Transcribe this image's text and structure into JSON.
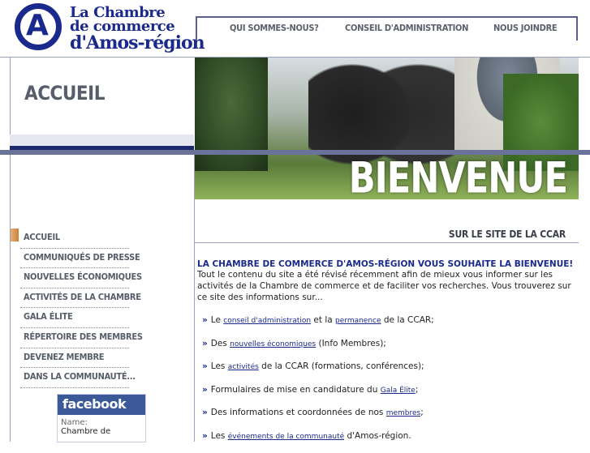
{
  "brand": {
    "l1": "La Chambre",
    "l2": "de commerce",
    "l3": "d'Amos-région",
    "icon": "logo-a-mark"
  },
  "topnav": [
    {
      "label": "QUI SOMMES-NOUS?"
    },
    {
      "label": "CONSEIL D'ADMINISTRATION"
    },
    {
      "label": "NOUS JOINDRE"
    }
  ],
  "page_title": "ACCUEIL",
  "hero": {
    "bienvenue": "BIENVENUE",
    "subtitle": "SUR LE SITE DE LA CCAR"
  },
  "sidenav": [
    {
      "label": "ACCUEIL"
    },
    {
      "label": "COMMUNIQUÉS DE PRESSE"
    },
    {
      "label": "NOUVELLES ÉCONOMIQUES"
    },
    {
      "label": "ACTIVITÉS DE LA CHAMBRE"
    },
    {
      "label": "GALA ÉLITE"
    },
    {
      "label": "RÉPERTOIRE DES MEMBRES"
    },
    {
      "label": "DEVENEZ MEMBRE"
    },
    {
      "label": "DANS LA COMMUNAUTÉ..."
    }
  ],
  "facebook": {
    "title": "facebook",
    "name_label": "Name:",
    "name_value": "Chambre de"
  },
  "content": {
    "headline": "LA CHAMBRE DE COMMERCE D'AMOS-RÉGION VOUS SOUHAITE LA BIENVENUE!",
    "intro": "Tout le contenu du site a été révisé récemment afin de mieux vous informer sur les activités de la Chambre de commerce et de faciliter vos recherches. Vous trouverez sur ce site des informations sur...",
    "bullet": "»",
    "items": [
      {
        "pre": "Le ",
        "link1": "conseil d'administration",
        "mid": " et la ",
        "link2": "permanence",
        "post": " de la CCAR;"
      },
      {
        "pre": "Des ",
        "link1": "nouvelles économiques",
        "post": " (Info Membres);"
      },
      {
        "pre": "Les ",
        "link1": "activités",
        "post": " de la CCAR (formations, conférences);"
      },
      {
        "pre": "Formulaires de mise en candidature du ",
        "link1": "Gala Élite",
        "post": ";"
      },
      {
        "pre": "Des informations et coordonnées de nos ",
        "link1": "membres",
        "post": ";"
      },
      {
        "pre": "Les ",
        "link1": "événements de la communauté",
        "post": " d'Amos-région."
      }
    ]
  },
  "colors": {
    "brand_blue": "#1a2a8c",
    "nav_gray": "#585d6a",
    "rule": "#6b7299",
    "facebook": "#3b5998"
  }
}
